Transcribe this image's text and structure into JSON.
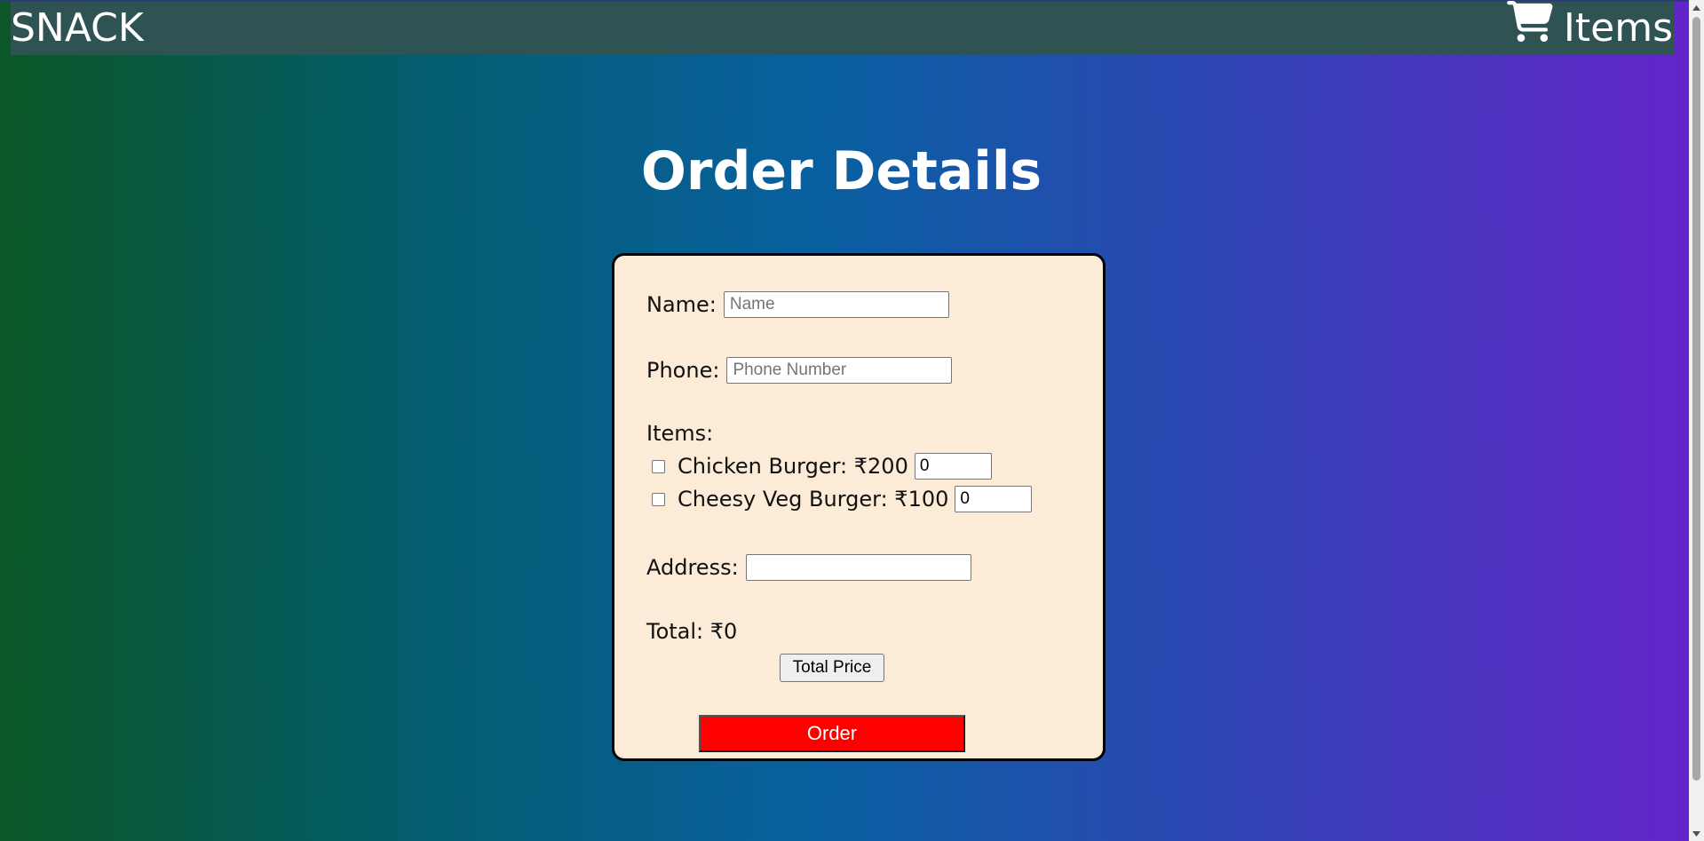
{
  "navbar": {
    "brand": "SNACK",
    "cart_label": "Items",
    "cart_icon": "shopping-cart-icon"
  },
  "page": {
    "title": "Order Details"
  },
  "form": {
    "name_label": "Name:",
    "name_placeholder": "Name",
    "name_value": "",
    "phone_label": "Phone:",
    "phone_placeholder": "Phone Number",
    "phone_value": "",
    "items_label": "Items:",
    "items": [
      {
        "label": "Chicken Burger: ₹200",
        "checked": false,
        "quantity": "0"
      },
      {
        "label": "Cheesy Veg Burger: ₹100",
        "checked": false,
        "quantity": "0"
      }
    ],
    "address_label": "Address:",
    "address_value": "",
    "total_text": "Total: ₹0",
    "total_button_label": "Total Price",
    "order_button_label": "Order"
  },
  "colors": {
    "navbar_bg": "#2f5252",
    "card_bg": "#fbebd7",
    "order_button_bg": "#ff0000",
    "gradient_start": "#0b5726",
    "gradient_end": "#6523c9"
  }
}
